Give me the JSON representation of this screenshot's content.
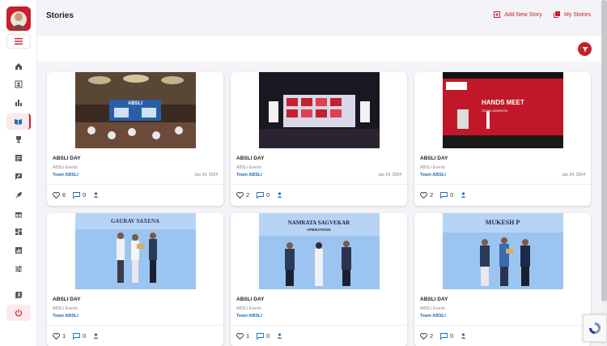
{
  "header": {
    "title": "Stories",
    "add_story": "Add New Story",
    "my_stories": "My Stories"
  },
  "colors": {
    "brand": "#c5202e",
    "link": "#1f6fb5"
  },
  "sidebar": {
    "items": [
      {
        "icon": "home-icon"
      },
      {
        "icon": "contact-card-icon"
      },
      {
        "icon": "bar-chart-icon"
      },
      {
        "icon": "book-icon",
        "active": true
      },
      {
        "icon": "trophy-icon"
      },
      {
        "icon": "article-icon"
      },
      {
        "icon": "chat-edit-icon"
      },
      {
        "icon": "rocket-icon"
      },
      {
        "icon": "gift-icon"
      },
      {
        "icon": "dashboard-icon"
      },
      {
        "icon": "report-icon"
      },
      {
        "icon": "sliders-icon"
      },
      {
        "icon": "user-report-icon"
      },
      {
        "icon": "power-icon"
      }
    ]
  },
  "stories": [
    {
      "title": "ABSLI DAY",
      "category": "ABSLI Events",
      "team": "Team ABSLI",
      "date": "Jun 24, 2024",
      "likes": "6",
      "comments": "0"
    },
    {
      "title": "ABSLI DAY",
      "category": "ABSLI Events",
      "team": "Team ABSLI",
      "date": "Jun 24, 2024",
      "likes": "2",
      "comments": "0"
    },
    {
      "title": "ABSLI DAY",
      "category": "ABSLI Events",
      "team": "Team ABSLI",
      "date": "Jun 24, 2024",
      "likes": "2",
      "comments": "0"
    },
    {
      "title": "ABSLI DAY",
      "category": "ABSLI Events",
      "team": "Team ABSLI",
      "date": "",
      "likes": "1",
      "comments": "0"
    },
    {
      "title": "ABSLI DAY",
      "category": "ABSLI Events",
      "team": "Team ABSLI",
      "date": "",
      "likes": "1",
      "comments": "0"
    },
    {
      "title": "ABSLI DAY",
      "category": "ABSLI Events",
      "team": "Team ABSLI",
      "date": "",
      "likes": "2",
      "comments": "0"
    }
  ],
  "images": {
    "img1_text": "ABSLI",
    "img3_banner": "HANDS MEET",
    "img3_sub": "CEO'S ADDRESS",
    "img4_name": "GAURAV SAXENA",
    "img5_name": "NAMRATA SAGVEKAR",
    "img5_sub": "OPERATIONS",
    "img6_name": "MUKESH P"
  }
}
